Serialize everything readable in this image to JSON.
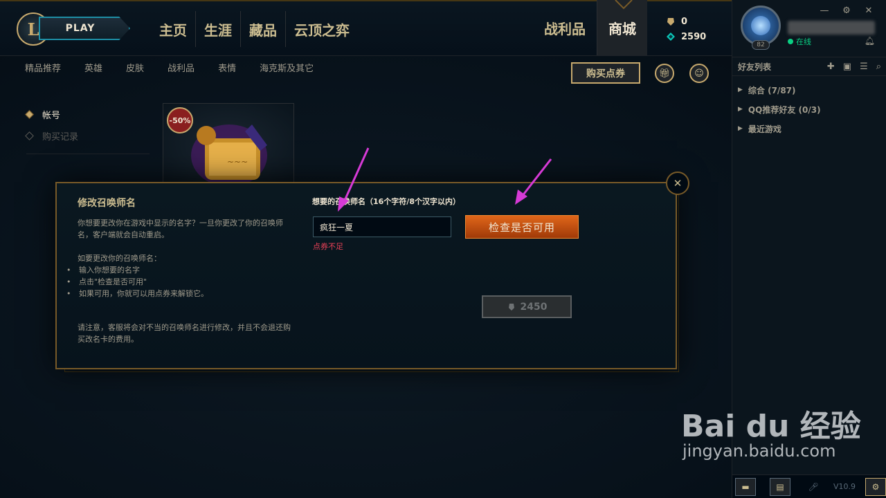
{
  "topbar": {
    "play_label": "PLAY",
    "nav_main": [
      "主页",
      "生涯",
      "藏品",
      "云顶之弈"
    ],
    "nav_right": [
      "战利品",
      "商城"
    ],
    "active_tab": "商城",
    "currency": {
      "blue_essence": "0",
      "riot_points": "2590"
    }
  },
  "profile": {
    "level": "82",
    "status": "在线"
  },
  "sidebar": {
    "friends_title": "好友列表",
    "groups": [
      "综合 (7/87)",
      "QQ推荐好友 (0/3)",
      "最近游戏"
    ],
    "version": "V10.9"
  },
  "subnav": [
    "精品推荐",
    "英雄",
    "皮肤",
    "战利品",
    "表情",
    "海克斯及其它"
  ],
  "buy_rp_label": "购买点券",
  "account_menu": {
    "items": [
      "帐号",
      "购买记录"
    ],
    "active": "帐号"
  },
  "card": {
    "discount": "-50%"
  },
  "modal": {
    "title": "修改召唤师名",
    "desc": "你想要更改你在游戏中显示的名字？一旦你更改了你的召唤师名，客户端就会自动重启。",
    "how_title": "如要更改你的召唤师名：",
    "steps": [
      "输入你想要的名字",
      "点击\"检查是否可用\"",
      "如果可用，你就可以用点券来解锁它。"
    ],
    "note": "请注意，客服将会对不当的召唤师名进行修改，并且不会退还购买改名卡的费用。",
    "field_label": "想要的召唤师名（16个字符/8个汉字以内）",
    "input_value": "疯狂一夏",
    "error": "点券不足",
    "check_label": "检查是否可用",
    "price": "2450"
  },
  "watermark": {
    "main": "Bai du 经验",
    "sub": "jingyan.baidu.com"
  },
  "colors": {
    "gold": "#c8aa6e",
    "accent_orange": "#e0661a",
    "error": "#e84057",
    "arrow": "#d63ad6"
  }
}
